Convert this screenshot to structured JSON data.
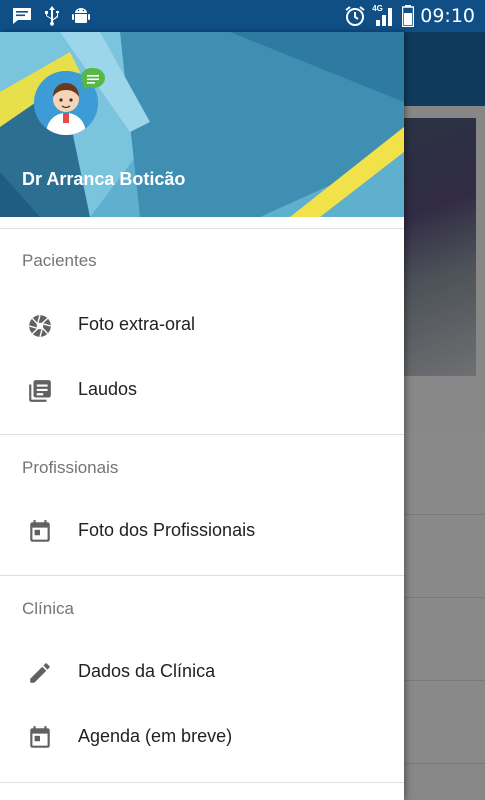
{
  "status_bar": {
    "time": "09:10",
    "network": "4G"
  },
  "drawer": {
    "user_name": "Dr Arranca Boticão",
    "sections": [
      {
        "title": "Pacientes",
        "items": [
          {
            "label": "Foto extra-oral",
            "icon": "camera-aperture-icon"
          },
          {
            "label": "Laudos",
            "icon": "library-books-icon"
          }
        ]
      },
      {
        "title": "Profissionais",
        "items": [
          {
            "label": "Foto dos Profissionais",
            "icon": "calendar-icon"
          }
        ]
      },
      {
        "title": "Clínica",
        "items": [
          {
            "label": "Dados da Clínica",
            "icon": "pencil-icon"
          },
          {
            "label": "Agenda (em breve)",
            "icon": "calendar-icon"
          }
        ]
      }
    ]
  },
  "colors": {
    "status_bar": "#0f4f86",
    "header_primary": "#1c6aa8",
    "header_teal": "#58a8c8",
    "accent_yellow": "#f5e14a",
    "icon_gray": "#616161"
  }
}
